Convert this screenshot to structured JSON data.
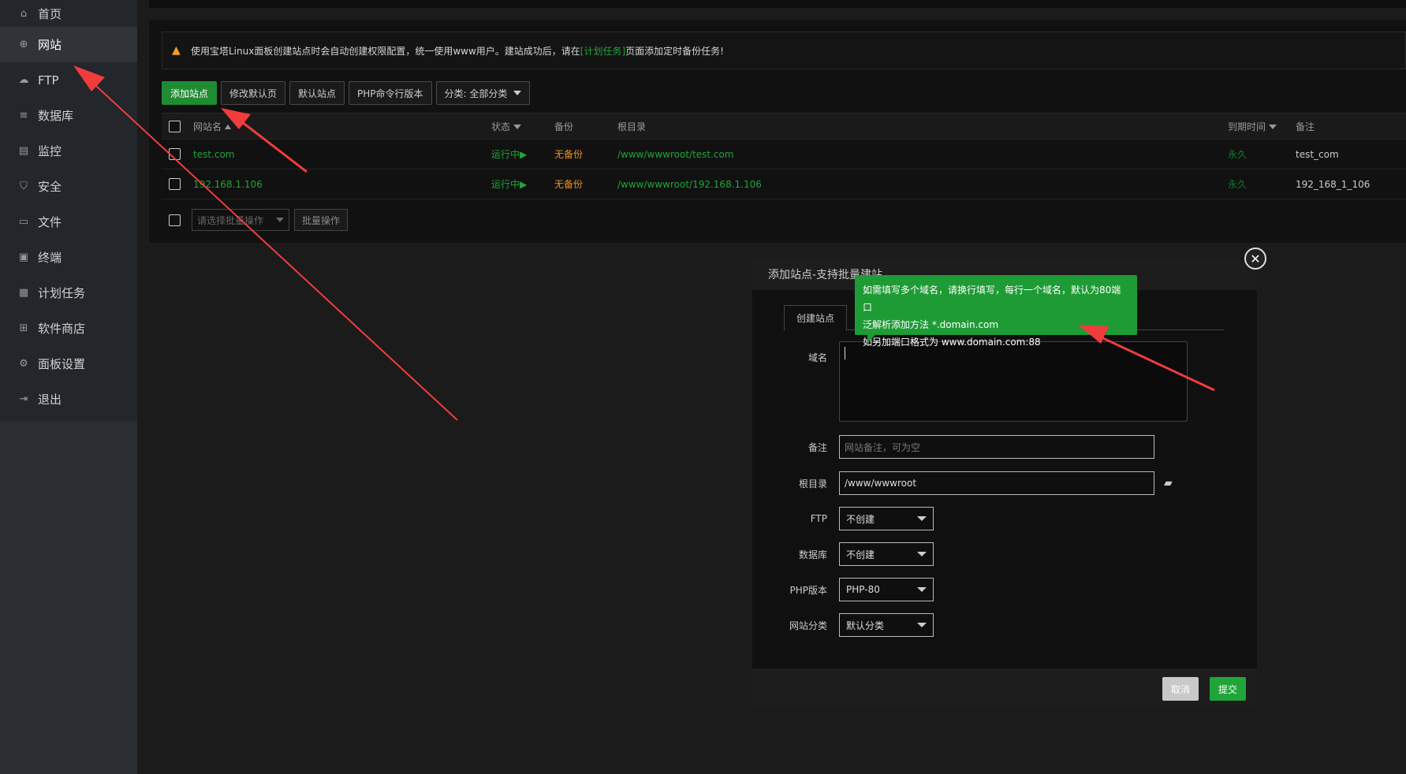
{
  "sidebar": {
    "items": [
      {
        "label": "首页",
        "icon": "home-icon"
      },
      {
        "label": "网站",
        "icon": "globe-icon"
      },
      {
        "label": "FTP",
        "icon": "ftp-icon"
      },
      {
        "label": "数据库",
        "icon": "database-icon"
      },
      {
        "label": "监控",
        "icon": "monitor-icon"
      },
      {
        "label": "安全",
        "icon": "shield-icon"
      },
      {
        "label": "文件",
        "icon": "folder-icon"
      },
      {
        "label": "终端",
        "icon": "terminal-icon"
      },
      {
        "label": "计划任务",
        "icon": "calendar-icon"
      },
      {
        "label": "软件商店",
        "icon": "grid-icon"
      },
      {
        "label": "面板设置",
        "icon": "gear-icon"
      },
      {
        "label": "退出",
        "icon": "logout-icon"
      }
    ],
    "active": "网站"
  },
  "notice": {
    "text_before": "使用宝塔Linux面板创建站点时会自动创建权限配置，统一使用www用户。建站成功后，请在",
    "link": "[计划任务]",
    "text_after": "页面添加定时备份任务!"
  },
  "toolbar": {
    "add_site": "添加站点",
    "edit_default_page": "修改默认页",
    "default_site": "默认站点",
    "php_cli_version": "PHP命令行版本",
    "category": "分类: 全部分类"
  },
  "table": {
    "headers": {
      "name": "网站名",
      "status": "状态",
      "backup": "备份",
      "root": "根目录",
      "expire": "到期时间",
      "note": "备注"
    },
    "rows": [
      {
        "name": "test.com",
        "status": "运行中▶",
        "backup": "无备份",
        "root": "/www/wwwroot/test.com",
        "expire": "永久",
        "note": "test_com"
      },
      {
        "name": "192.168.1.106",
        "status": "运行中▶",
        "backup": "无备份",
        "root": "/www/wwwroot/192.168.1.106",
        "expire": "永久",
        "note": "192_168_1_106"
      }
    ]
  },
  "batch": {
    "placeholder": "请选择批量操作",
    "button": "批量操作"
  },
  "dialog": {
    "title": "添加站点-支持批量建站",
    "tab": "创建站点",
    "labels": {
      "domain": "域名",
      "note": "备注",
      "root": "根目录",
      "ftp": "FTP",
      "database": "数据库",
      "php": "PHP版本",
      "category": "网站分类"
    },
    "values": {
      "domain": "",
      "note_placeholder": "网站备注，可为空",
      "root": "/www/wwwroot",
      "ftp": "不创建",
      "database": "不创建",
      "php": "PHP-80",
      "category": "默认分类"
    },
    "cancel": "取消",
    "submit": "提交"
  },
  "tooltip": {
    "line1": "如需填写多个域名，请换行填写，每行一个域名，默认为80端口",
    "line2": "泛解析添加方法 *.domain.com",
    "line3": "如另加端口格式为 www.domain.com:88"
  },
  "colors": {
    "accent_green": "#20a53a",
    "warning_orange": "#e8902a",
    "annotation_red": "#f03c3c"
  }
}
